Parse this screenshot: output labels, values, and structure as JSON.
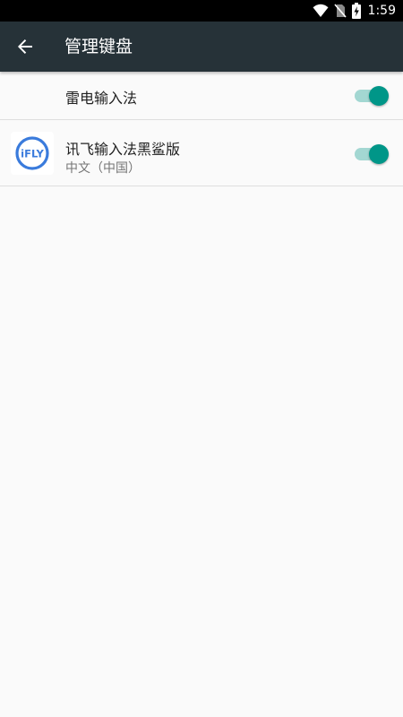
{
  "status_bar": {
    "time": "1:59",
    "icons": [
      "wifi-icon",
      "no-sim-icon",
      "battery-charging-icon"
    ]
  },
  "toolbar": {
    "title": "管理键盘",
    "back_icon": "arrow-back-icon"
  },
  "keyboards": [
    {
      "name": "雷电输入法",
      "subtitle": "",
      "enabled": true,
      "icon": null
    },
    {
      "name": "讯飞输入法黑鲨版",
      "subtitle": "中文（中国）",
      "enabled": true,
      "icon": "ifly-logo-icon",
      "icon_text": "iFLY"
    }
  ],
  "colors": {
    "status_bar": "#000000",
    "toolbar": "#263238",
    "background": "#fafafa",
    "switch_accent": "#009688",
    "ifly_blue": "#3a7bdc"
  }
}
